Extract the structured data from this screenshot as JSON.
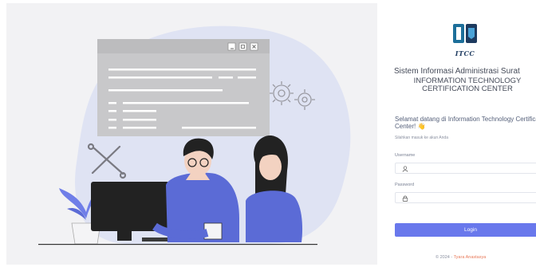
{
  "app": {
    "title": "Sistem Informasi Administrasi Surat",
    "logo_text": "ITCC",
    "org_name": "INFORMATION TECHNOLOGY CERTIFICATION CENTER"
  },
  "login": {
    "welcome": "Selamat datang di Information Technology Certification Center!",
    "welcome_emoji": "👋",
    "hint": "Silahkan masuk ke akun Anda",
    "username_label": "Username",
    "username_value": "",
    "password_label": "Password",
    "password_value": "",
    "button_label": "Login"
  },
  "footer": {
    "copyright": "© 2024 -",
    "author": "Tyara Anastasya"
  },
  "icons": {
    "username": "user-icon",
    "password": "lock-icon",
    "toggle": "eye-icon"
  },
  "colors": {
    "primary": "#6978ec",
    "illustration_accent": "#5b6bd6",
    "logo": "#1d6f9a",
    "footer_author": "#e87a5a"
  }
}
